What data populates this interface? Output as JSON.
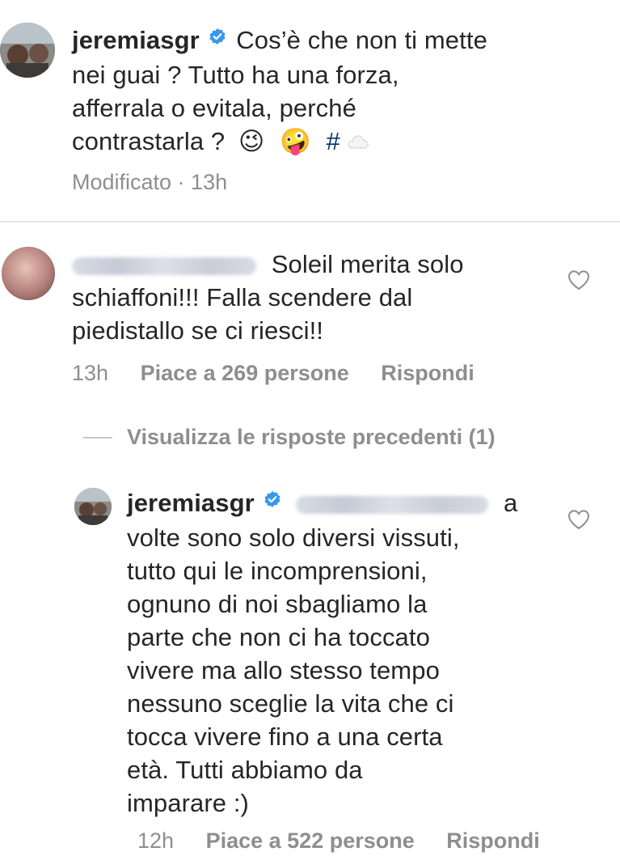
{
  "caption": {
    "username": "jeremiasgr",
    "lines": [
      "Cos’è che non ti mette",
      "nei guai ? Tutto ha una forza,",
      "afferrala o evitala, perché",
      "contrastarla ?"
    ],
    "emojis": [
      "😉",
      "🤪"
    ],
    "hashtag_prefix": "#",
    "meta": "Modificato · 13h"
  },
  "comment1": {
    "text_first": "Soleil merita solo",
    "lines": [
      "schiaffoni!!! Falla scendere dal",
      "piedistallo se ci riesci!!"
    ],
    "time": "13h",
    "likes": "Piace a 269 persone",
    "reply": "Rispondi"
  },
  "view_previous": "Visualizza le risposte precedenti (1)",
  "reply1": {
    "username": "jeremiasgr",
    "after_mention": "a",
    "lines": [
      "volte sono solo diversi vissuti,",
      "tutto qui le incomprensioni,",
      "ognuno di noi sbagliamo la",
      "parte che non ci ha toccato",
      "vivere ma allo stesso tempo",
      "nessuno sceglie la vita che ci",
      "tocca vivere fino a una certa",
      "età. Tutti abbiamo da",
      "imparare :)"
    ],
    "time": "12h",
    "likes": "Piace a 522 persone",
    "reply": "Rispondi"
  },
  "colors": {
    "text": "#262626",
    "secondary": "#8e8e8e",
    "verified": "#3897f0",
    "hashtag": "#00376b"
  },
  "icons": [
    "verified-badge-icon",
    "heart-icon",
    "cloud-icon"
  ]
}
